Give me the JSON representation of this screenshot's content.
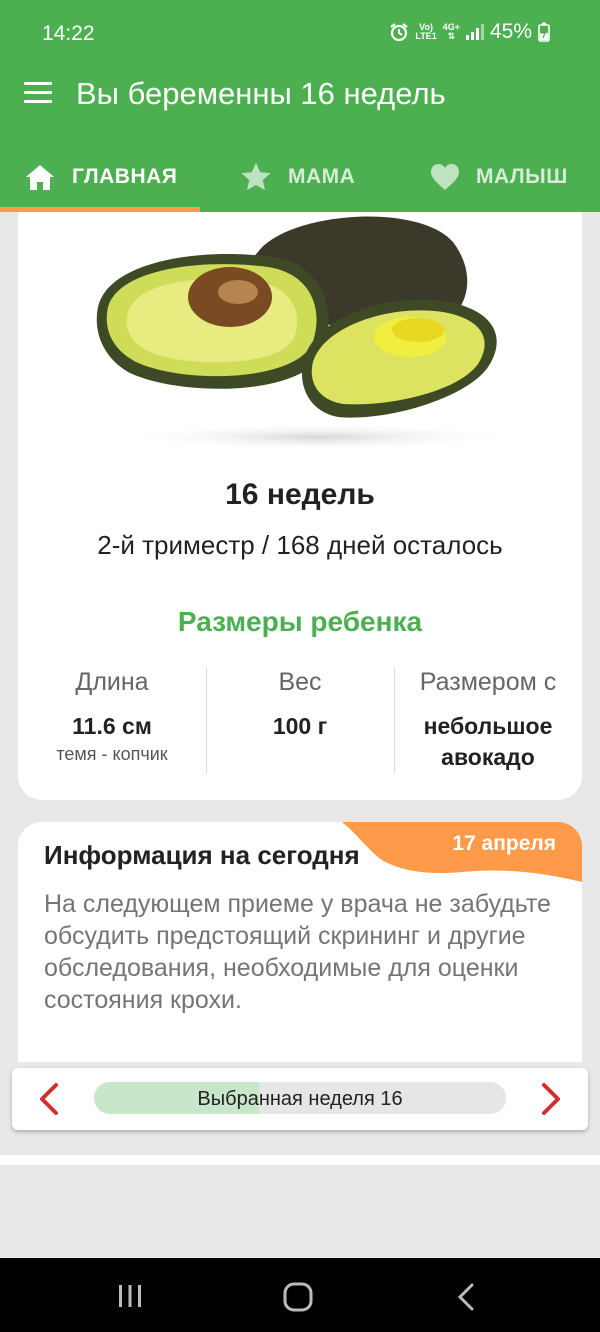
{
  "status_bar": {
    "time": "14:22",
    "net_top": "Vo)",
    "net_bottom": "LTE1",
    "net2_top": "4G+",
    "battery": "45%"
  },
  "app_bar": {
    "title": "Вы беременны 16 недель"
  },
  "tabs": [
    {
      "label": "ГЛАВНАЯ",
      "icon": "home-icon",
      "selected": true
    },
    {
      "label": "МАМА",
      "icon": "star-icon",
      "selected": false
    },
    {
      "label": "МАЛЫШ",
      "icon": "heart-icon",
      "selected": false
    }
  ],
  "colors": {
    "primary": "#4caf50",
    "accent": "#ff9a4a",
    "arrow": "#d32f2f"
  },
  "summary": {
    "fruit_image": "avocado-image",
    "weeks": "16 недель",
    "trimester": "2-й триместр / 168 дней осталось",
    "sizes_title": "Размеры ребенка",
    "length_label": "Длина",
    "length_value": "11.6 см",
    "length_sub": "темя - копчик",
    "weight_label": "Вес",
    "weight_value": "100 г",
    "size_label": "Размером с",
    "size_value": "небольшое авокадо"
  },
  "info": {
    "title": "Информация на сегодня",
    "date": "17 апреля",
    "text": "На следующем приеме у врача не забудьте обсудить предстоящий скрининг и другие обследования, необходимые для оценки состояния крохи."
  },
  "week_selector": {
    "label": "Выбранная неделя 16",
    "progress_fraction": 0.4
  }
}
